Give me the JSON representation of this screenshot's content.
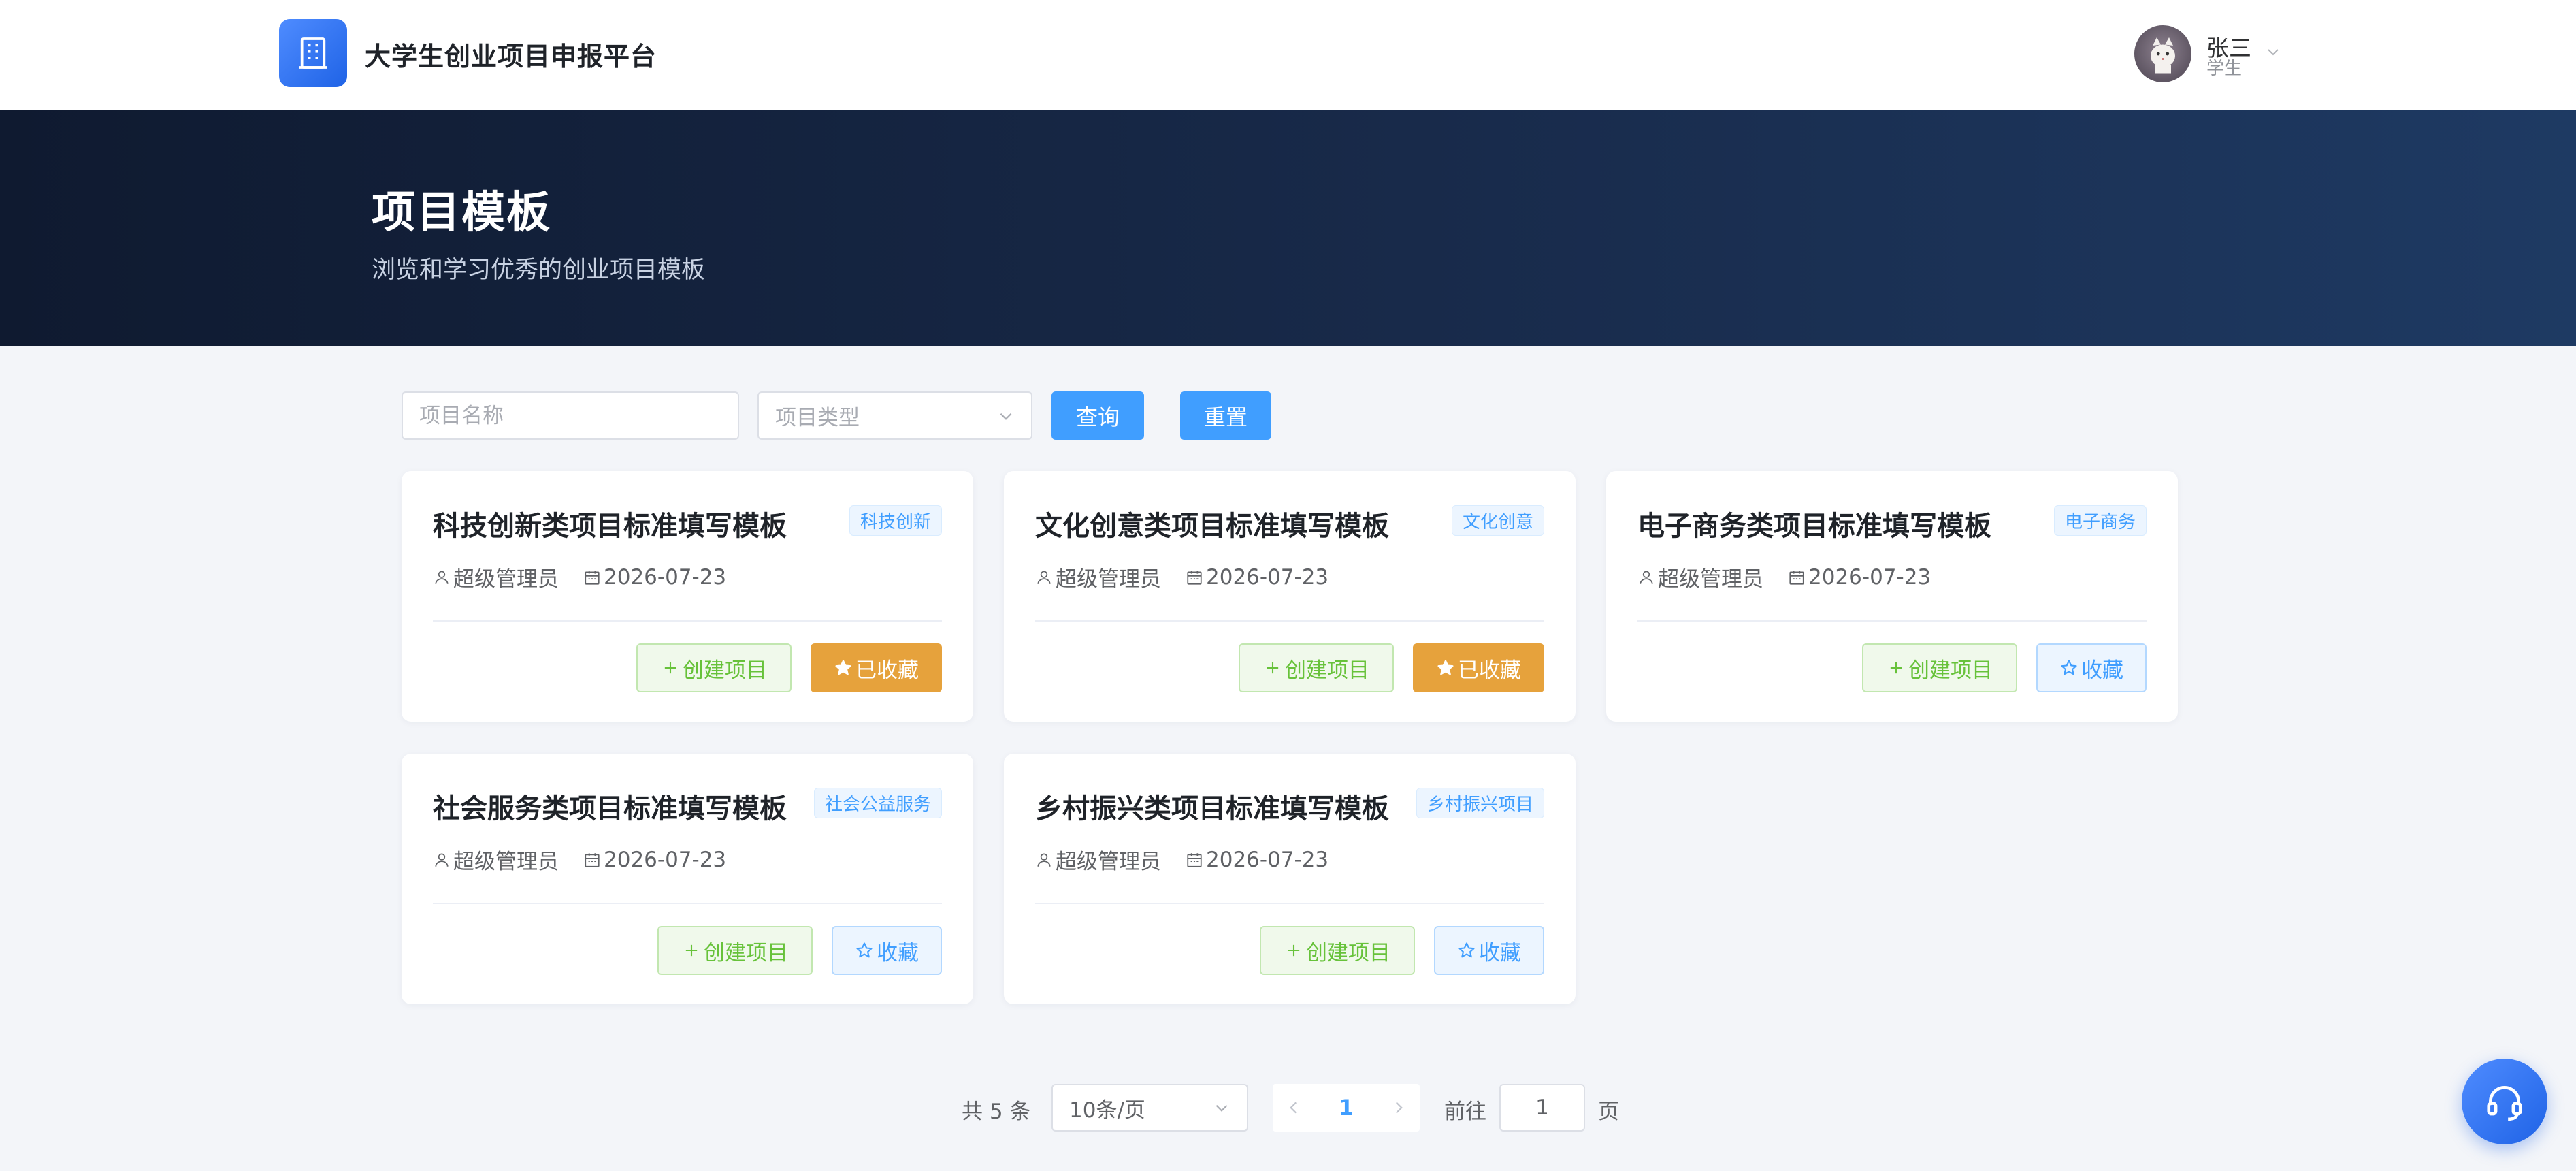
{
  "header": {
    "brand": "大学生创业项目申报平台",
    "logo_icon": "building-icon",
    "user_name": "张三",
    "user_role": "学生"
  },
  "banner": {
    "title": "项目模板",
    "subtitle": "浏览和学习优秀的创业项目模板"
  },
  "search": {
    "name_placeholder": "项目名称",
    "type_placeholder": "项目类型",
    "query_label": "查询",
    "reset_label": "重置"
  },
  "cards": [
    {
      "title": "科技创新类项目标准填写模板",
      "tag": "科技创新",
      "author": "超级管理员",
      "date": "2026-07-23",
      "create_label": "创建项目",
      "fav_label": "已收藏",
      "favorited": true
    },
    {
      "title": "文化创意类项目标准填写模板",
      "tag": "文化创意",
      "author": "超级管理员",
      "date": "2026-07-23",
      "create_label": "创建项目",
      "fav_label": "已收藏",
      "favorited": true
    },
    {
      "title": "电子商务类项目标准填写模板",
      "tag": "电子商务",
      "author": "超级管理员",
      "date": "2026-07-23",
      "create_label": "创建项目",
      "fav_label": "收藏",
      "favorited": false
    },
    {
      "title": "社会服务类项目标准填写模板",
      "tag": "社会公益服务",
      "author": "超级管理员",
      "date": "2026-07-23",
      "create_label": "创建项目",
      "fav_label": "收藏",
      "favorited": false
    },
    {
      "title": "乡村振兴类项目标准填写模板",
      "tag": "乡村振兴项目",
      "author": "超级管理员",
      "date": "2026-07-23",
      "create_label": "创建项目",
      "fav_label": "收藏",
      "favorited": false
    }
  ],
  "pagination": {
    "total_text": "共 5 条",
    "page_size": "10条/页",
    "current_page": "1",
    "goto_label": "前往",
    "goto_value": "1",
    "page_label": "页"
  },
  "colors": {
    "primary": "#409eff",
    "success": "#67c23a",
    "warning": "#e6a23c",
    "banner_dark": "#0f1a30"
  },
  "floating": {
    "support_icon": "headset-icon"
  }
}
